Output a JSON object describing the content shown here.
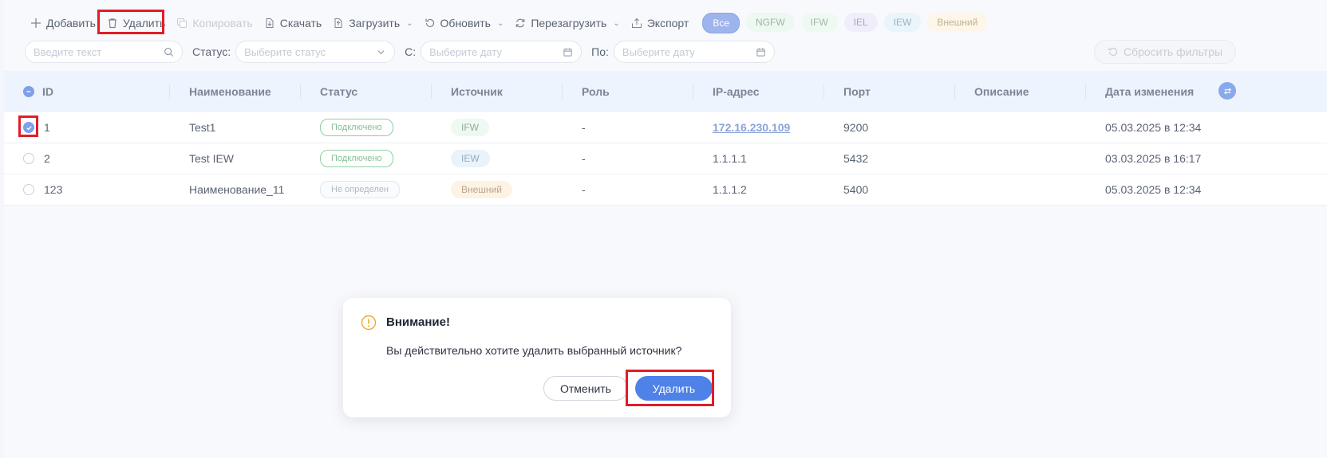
{
  "toolbar": {
    "add_label": "Добавить",
    "delete_label": "Удалить",
    "copy_label": "Копировать",
    "download_label": "Скачать",
    "upload_label": "Загрузить",
    "refresh_label": "Обновить",
    "reboot_label": "Перезагрузить",
    "export_label": "Экспорт"
  },
  "chips": [
    "Все",
    "NGFW",
    "IFW",
    "IEL",
    "IEW",
    "Внешний"
  ],
  "filters": {
    "search_placeholder": "Введите текст",
    "status_label": "Статус:",
    "status_placeholder": "Выберите статус",
    "from_label": "С:",
    "from_placeholder": "Выберите дату",
    "to_label": "По:",
    "to_placeholder": "Выберите дату",
    "reset_label": "Сбросить фильтры"
  },
  "table": {
    "columns": [
      "ID",
      "Наименование",
      "Статус",
      "Источник",
      "Роль",
      "IP-адрес",
      "Порт",
      "Описание",
      "Дата изменения"
    ],
    "rows": [
      {
        "id": "1",
        "name": "Test1",
        "status": "Подключено",
        "source": "IFW",
        "role": "-",
        "ip": "172.16.230.109",
        "port": "9200",
        "description": "",
        "date": "05.03.2025 в 12:34"
      },
      {
        "id": "2",
        "name": "Test IEW",
        "status": "Подключено",
        "source": "IEW",
        "role": "-",
        "ip": "1.1.1.1",
        "port": "5432",
        "description": "",
        "date": "03.03.2025 в 16:17"
      },
      {
        "id": "123",
        "name": "Наименование_11",
        "status": "Не определен",
        "source": "Внешний",
        "role": "-",
        "ip": "1.1.1.2",
        "port": "5400",
        "description": "",
        "date": "05.03.2025 в 12:34"
      }
    ]
  },
  "dialog": {
    "title": "Внимание!",
    "message": "Вы действительно хотите удалить выбранный источник?",
    "cancel_label": "Отменить",
    "confirm_label": "Удалить"
  },
  "colors": {
    "accent": "#4f82e8",
    "highlight": "#e01d28",
    "warning": "#f0a92b"
  }
}
